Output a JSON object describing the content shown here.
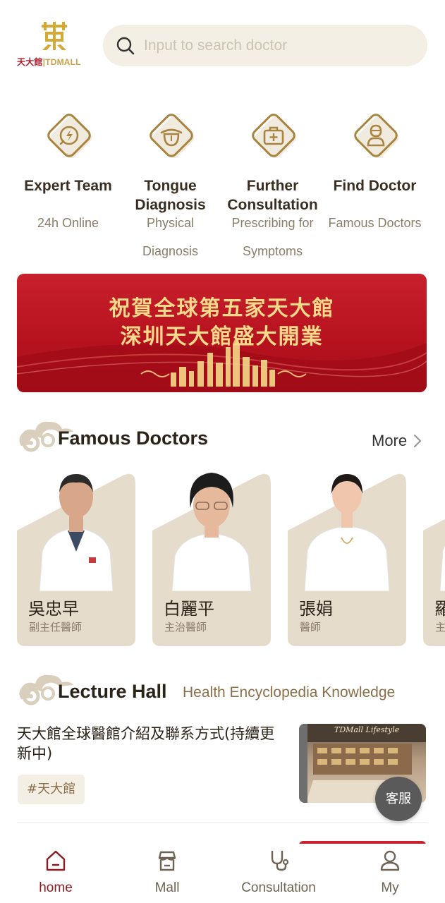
{
  "brand": {
    "logo_cn": "天大館",
    "logo_sep": "|",
    "logo_en": "TDMALL",
    "color_gold": "#c9a24a",
    "color_red": "#b3192b"
  },
  "search": {
    "placeholder": "Input to search doctor"
  },
  "quick_menu": [
    {
      "title": "Expert Team",
      "subtitle": "24h Online",
      "icon": "lightning-chat-icon"
    },
    {
      "title": "Tongue Diagnosis",
      "subtitle": "Physical Diagnosis",
      "icon": "tongue-icon"
    },
    {
      "title": "Further Consultation",
      "subtitle": "Prescribing for Symptoms",
      "icon": "medical-kit-icon"
    },
    {
      "title": "Find Doctor",
      "subtitle": "Famous Doctors",
      "icon": "doctor-icon"
    }
  ],
  "banner": {
    "line1": "祝賀全球第五家天大館",
    "line2": "深圳天大館盛大開業"
  },
  "famous_doctors": {
    "title": "Famous Doctors",
    "more_label": "More",
    "doctors": [
      {
        "name": "吳忠早",
        "title": "副主任醫師"
      },
      {
        "name": "白麗平",
        "title": "主治醫師"
      },
      {
        "name": "張娟",
        "title": "醫師"
      },
      {
        "name": "羅",
        "title": "主"
      }
    ]
  },
  "lecture_hall": {
    "title": "Lecture Hall",
    "subtitle": "Health Encyclopedia Knowledge",
    "articles": [
      {
        "title": "天大館全球醫館介紹及聯系方式(持續更新中)",
        "tag": "#天大館",
        "thumb_caption": "TDMall Lifestyle"
      }
    ]
  },
  "customer_service": {
    "label": "客服"
  },
  "tabbar": [
    {
      "label": "home",
      "icon": "home-icon",
      "active": true
    },
    {
      "label": "Mall",
      "icon": "store-icon",
      "active": false
    },
    {
      "label": "Consultation",
      "icon": "stethoscope-icon",
      "active": false
    },
    {
      "label": "My",
      "icon": "user-icon",
      "active": false
    }
  ],
  "colors": {
    "accent": "#8c1c24",
    "gold": "#b08a4a",
    "beige": "#f4efe5",
    "card": "#e7dfd1"
  }
}
